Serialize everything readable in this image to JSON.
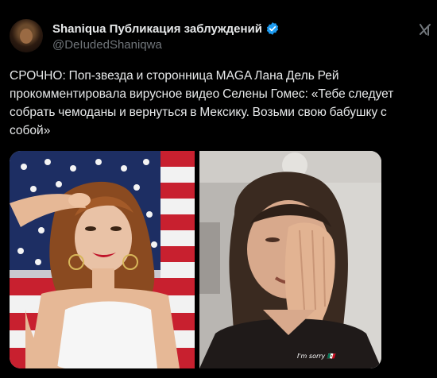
{
  "post": {
    "author": {
      "display_name": "Shaniqua Публикация заблуждений",
      "handle": "@DeIudedShaniqwa",
      "verified": true
    },
    "text": "СРОЧНО: Поп-звезда и сторонница MAGA Лана Дель Рей прокомментировала вирусное видео Селены Гомес: «Тебе следует собрать чемоданы и вернуться в Мексику. Возьми свою бабушку с собой»",
    "media": {
      "right_caption": "I'm sorry 🇲🇽"
    }
  },
  "colors": {
    "background": "#000000",
    "text": "#e7e9ea",
    "secondary_text": "#71767b",
    "verified_badge": "#1d9bf0"
  },
  "icons": {
    "verified": "verified-badge-icon",
    "grok": "grok-icon"
  }
}
